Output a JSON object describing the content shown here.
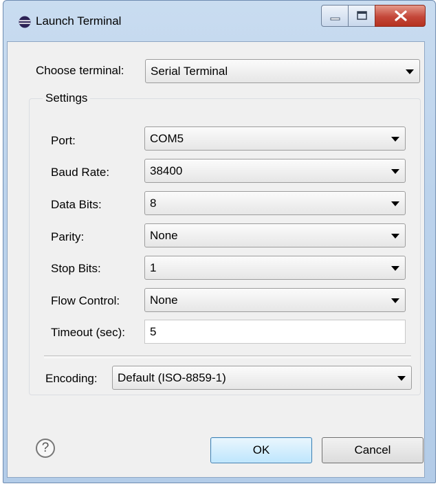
{
  "window": {
    "title": "Launch Terminal",
    "icon": "eclipse-icon"
  },
  "choose_terminal": {
    "label": "Choose terminal:",
    "value": "Serial Terminal"
  },
  "settings": {
    "group_label": "Settings",
    "fields": [
      {
        "label": "Port:",
        "value": "COM5"
      },
      {
        "label": "Baud Rate:",
        "value": "38400"
      },
      {
        "label": "Data Bits:",
        "value": "8"
      },
      {
        "label": "Parity:",
        "value": "None"
      },
      {
        "label": "Stop Bits:",
        "value": "1"
      },
      {
        "label": "Flow Control:",
        "value": "None"
      }
    ],
    "timeout": {
      "label": "Timeout (sec):",
      "value": "5"
    },
    "encoding": {
      "label": "Encoding:",
      "value": "Default (ISO-8859-1)"
    }
  },
  "footer": {
    "help_glyph": "?",
    "ok_label": "OK",
    "cancel_label": "Cancel"
  },
  "colors": {
    "title_bar": "#bcd3ec",
    "close_button": "#c4473a",
    "dialog_bg": "#f0f0f0",
    "ok_button": "#bee6fd"
  }
}
